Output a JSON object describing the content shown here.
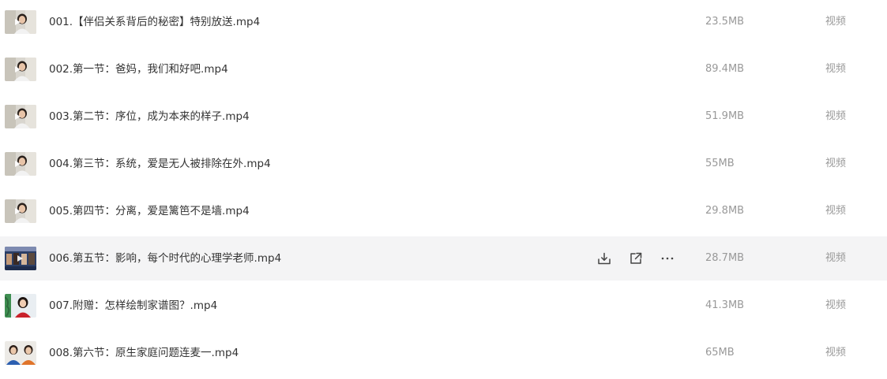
{
  "files": [
    {
      "name": "001.【伴侣关系背后的秘密】特别放送.mp4",
      "size": "23.5MB",
      "type": "视频",
      "thumb": "thumb-a"
    },
    {
      "name": "002.第一节：爸妈，我们和好吧.mp4",
      "size": "89.4MB",
      "type": "视频",
      "thumb": "thumb-a"
    },
    {
      "name": "003.第二节：序位，成为本来的样子.mp4",
      "size": "51.9MB",
      "type": "视频",
      "thumb": "thumb-a"
    },
    {
      "name": "004.第三节：系统，爱是无人被排除在外.mp4",
      "size": "55MB",
      "type": "视频",
      "thumb": "thumb-a"
    },
    {
      "name": "005.第四节：分离，爱是篱笆不是墙.mp4",
      "size": "29.8MB",
      "type": "视频",
      "thumb": "thumb-a"
    },
    {
      "name": "006.第五节：影响，每个时代的心理学老师.mp4",
      "size": "28.7MB",
      "type": "视频",
      "thumb": "thumb-b"
    },
    {
      "name": "007.附赠：怎样绘制家谱图？.mp4",
      "size": "41.3MB",
      "type": "视频",
      "thumb": "thumb-c"
    },
    {
      "name": "008.第六节：原生家庭问题连麦一.mp4",
      "size": "65MB",
      "type": "视频",
      "thumb": "thumb-d"
    }
  ],
  "hovered_row": 5,
  "row_actions": [
    {
      "icon": "download-icon"
    },
    {
      "icon": "share-icon"
    },
    {
      "icon": "more-icon"
    }
  ],
  "colors": {
    "hover_bg": "#f4f4f5",
    "name_text": "#333333",
    "meta_text": "#999999"
  }
}
